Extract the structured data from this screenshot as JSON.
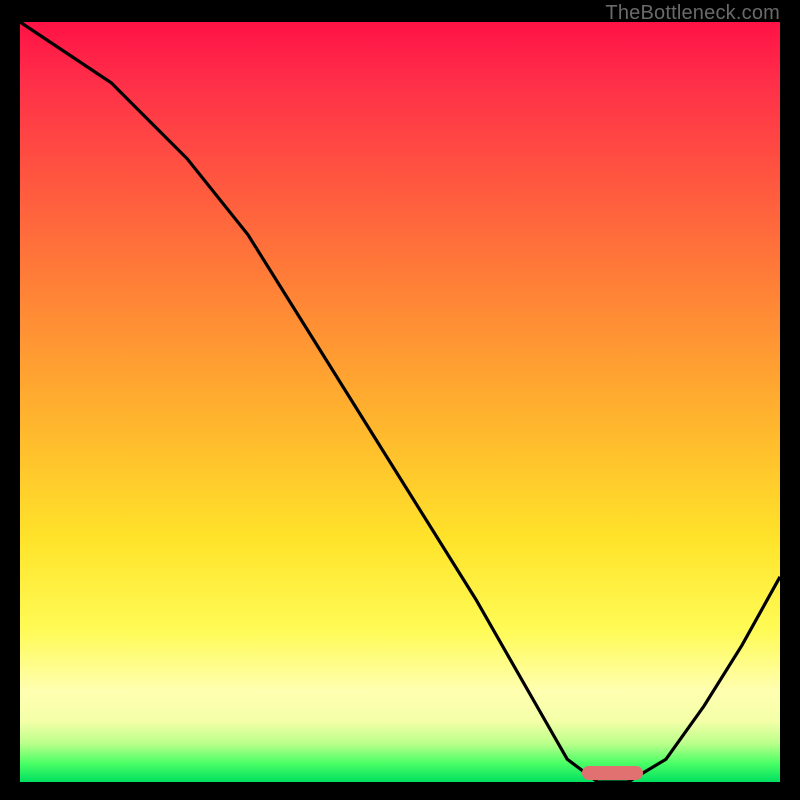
{
  "watermark": "TheBottleneck.com",
  "colors": {
    "gradient_top": "#ff1246",
    "gradient_mid": "#ffe32a",
    "gradient_bottom": "#00e060",
    "curve": "#000000",
    "marker": "#e17070",
    "frame": "#000000"
  },
  "chart_data": {
    "type": "line",
    "title": "",
    "xlabel": "",
    "ylabel": "",
    "xlim": [
      0,
      100
    ],
    "ylim": [
      0,
      100
    ],
    "series": [
      {
        "name": "bottleneck-curve",
        "x": [
          0,
          12,
          22,
          30,
          40,
          50,
          60,
          68,
          72,
          76,
          80,
          85,
          90,
          95,
          100
        ],
        "values": [
          100,
          92,
          82,
          72,
          56,
          40,
          24,
          10,
          3,
          0,
          0,
          3,
          10,
          18,
          27
        ]
      }
    ],
    "annotations": [
      {
        "name": "optimal-range-marker",
        "x_start": 74,
        "x_end": 82,
        "y": 0
      }
    ],
    "grid": false,
    "legend": false
  }
}
